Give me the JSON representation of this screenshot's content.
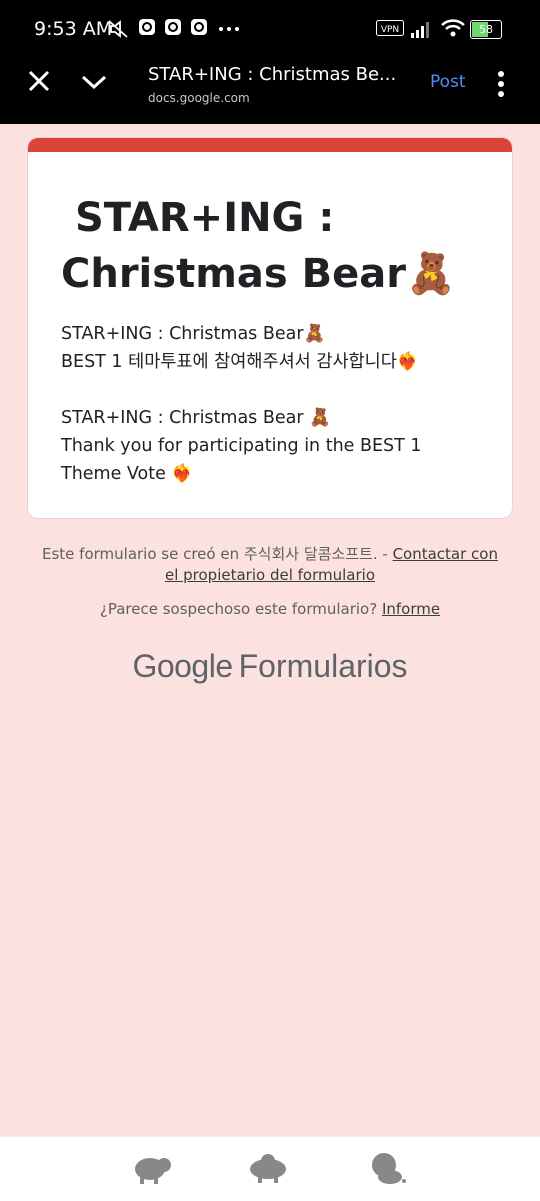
{
  "status": {
    "time": "9:53 AM",
    "vpn": "VPN",
    "battery": "58"
  },
  "browser": {
    "title": "STAR+ING : Christmas Be...",
    "url": "docs.google.com",
    "post_label": "Post"
  },
  "form": {
    "title_line1": "STAR+ING :",
    "title_line2": "Christmas Bear",
    "title_emoji": "🧸",
    "desc_lines": [
      "STAR+ING : Christmas Bear🧸",
      "BEST 1 테마투표에 참여해주셔서 감사합니다❤️‍🔥",
      "STAR+ING : Christmas Bear 🧸",
      "Thank you for participating in the BEST 1",
      "Theme Vote ❤️‍🔥"
    ]
  },
  "footer": {
    "created_prefix": "Este formulario se creó en 주식회사 달콤소프트. - ",
    "contact_link": "Contactar con el propietario del formulario",
    "suspicious_prefix": "¿Parece sospechoso este formulario? ",
    "report_link": "Informe",
    "brand_google": "Google",
    "brand_forms": "Formularios"
  },
  "colors": {
    "accent": "#db4437",
    "page_bg": "#fbe2e0",
    "post_blue": "#4c8df6"
  }
}
